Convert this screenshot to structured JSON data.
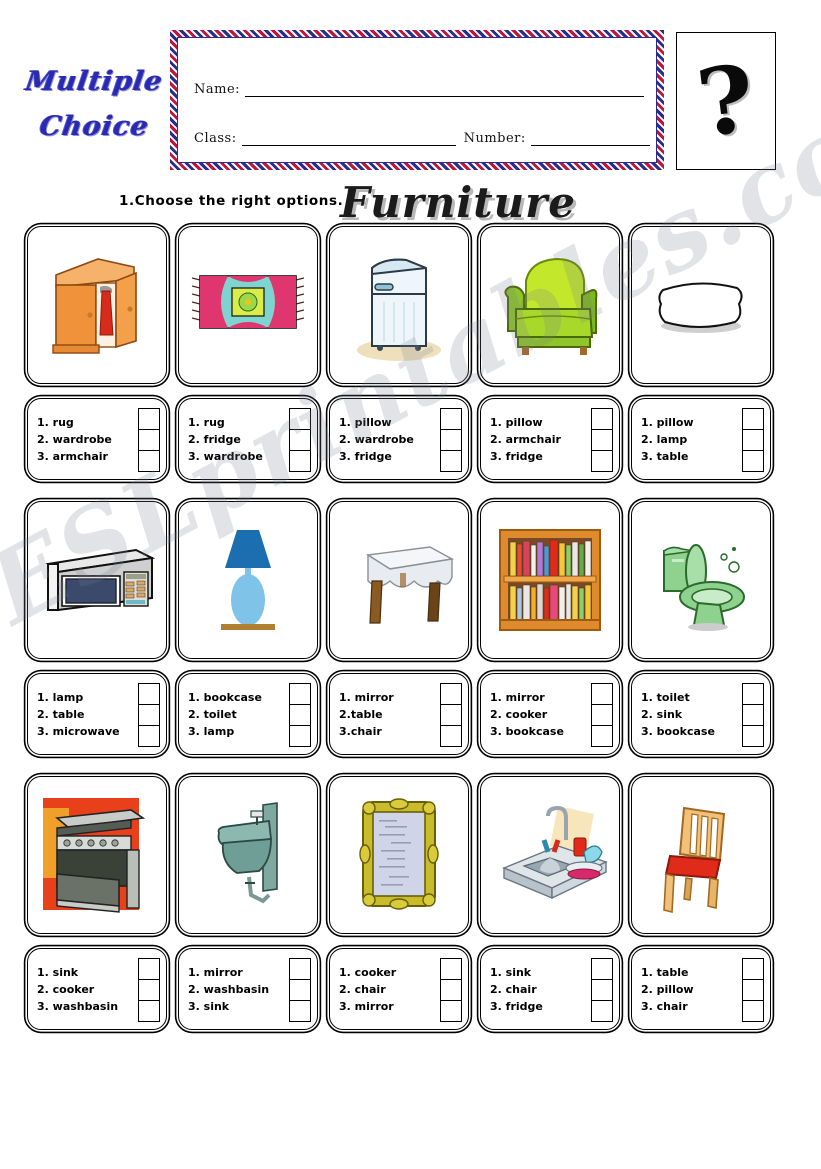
{
  "header": {
    "title_line1": "Multiple",
    "title_line2": "Choice",
    "name_label": "Name:",
    "class_label": "Class:",
    "number_label": "Number:",
    "question_mark": "?"
  },
  "instruction": "1.Choose the right options.",
  "topic": "Furniture",
  "watermark": "ESLprintables.com",
  "colors": {
    "title_blue": "#2a2ab0",
    "stripe_red": "#c0143c",
    "stripe_blue": "#2b2b8f",
    "wardrobe_orange": "#f0923a",
    "armchair_green": "#9ad11a",
    "toilet_green": "#8fd18f",
    "bookcase_orange": "#e08a2e",
    "chair_red": "#d8271f",
    "lamp_blue": "#1b6fb0",
    "washbasin_teal": "#6f9e96",
    "mirror_gold": "#c8bc2a"
  },
  "grid": {
    "rows": [
      {
        "cells": [
          {
            "picture": "wardrobe-image",
            "options": [
              "1. rug",
              "2. wardrobe",
              "3. armchair"
            ]
          },
          {
            "picture": "rug-image",
            "options": [
              "1. rug",
              "2. fridge",
              "3. wardrobe"
            ]
          },
          {
            "picture": "fridge-image",
            "options": [
              "1. pillow",
              "2. wardrobe",
              "3. fridge"
            ]
          },
          {
            "picture": "armchair-image",
            "options": [
              "1. pillow",
              "2. armchair",
              "3. fridge"
            ]
          },
          {
            "picture": "pillow-image",
            "options": [
              "1. pillow",
              "2. lamp",
              "3. table"
            ]
          }
        ]
      },
      {
        "cells": [
          {
            "picture": "microwave-image",
            "options": [
              "1. lamp",
              "2. table",
              "3. microwave"
            ]
          },
          {
            "picture": "lamp-image",
            "options": [
              "1. bookcase",
              "2. toilet",
              "3. lamp"
            ]
          },
          {
            "picture": "table-image",
            "options": [
              "1. mirror",
              "2.table",
              "3.chair"
            ]
          },
          {
            "picture": "bookcase-image",
            "options": [
              "1. mirror",
              "2. cooker",
              "3. bookcase"
            ]
          },
          {
            "picture": "toilet-image",
            "options": [
              "1. toilet",
              "2. sink",
              "3. bookcase"
            ]
          }
        ]
      },
      {
        "cells": [
          {
            "picture": "cooker-image",
            "options": [
              "1. sink",
              "2. cooker",
              "3. washbasin"
            ]
          },
          {
            "picture": "washbasin-image",
            "options": [
              "1. mirror",
              "2. washbasin",
              "3. sink"
            ]
          },
          {
            "picture": "mirror-image",
            "options": [
              "1. cooker",
              "2. chair",
              "3. mirror"
            ]
          },
          {
            "picture": "sink-image",
            "options": [
              "1. sink",
              "2. chair",
              "3. fridge"
            ]
          },
          {
            "picture": "chair-image",
            "options": [
              "1. table",
              "2. pillow",
              "3. chair"
            ]
          }
        ]
      }
    ]
  }
}
